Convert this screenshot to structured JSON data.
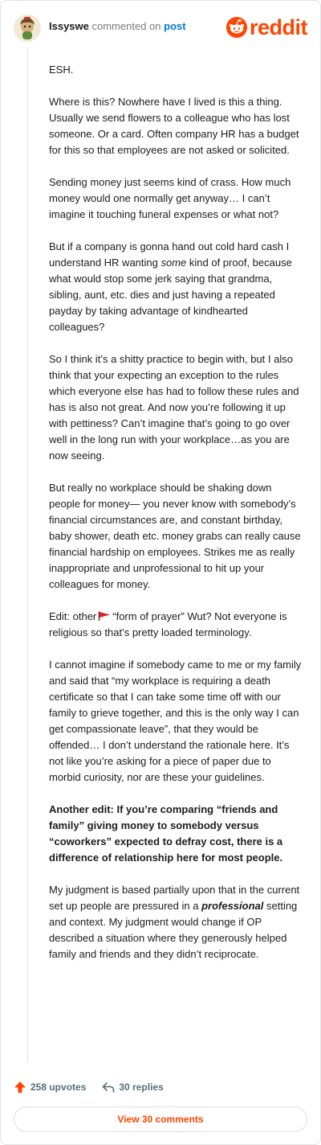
{
  "header": {
    "username": "Issyswe",
    "commented_on": "commented on",
    "post_link": "post",
    "brand": "reddit"
  },
  "comment": {
    "p1": "ESH.",
    "p2": "Where is this? Nowhere have I lived is this a thing. Usually we send flowers to a colleague who has lost someone. Or a card. Often company HR has a budget for this so that employees are not asked or solicited.",
    "p3": "Sending money just seems kind of crass. How much money would one normally get anyway… I can’t imagine it touching funeral expenses or what not?",
    "p4_a": "But if a company is gonna hand out cold hard cash I understand HR wanting ",
    "p4_em": "some",
    "p4_b": " kind of proof, because what would stop some jerk saying that grandma, sibling, aunt, etc. dies and just having a repeated payday by taking advantage of kindhearted colleagues?",
    "p5": "So I think it’s a shitty practice to begin with, but I also think that your expecting an exception to the rules which everyone else has had to follow these rules and has is also not great. And now you’re following it up with pettiness? Can’t imagine that’s going to go over well in the long run with your workplace…as you are now seeing.",
    "p6": "But really no workplace should be shaking down people for money— you never know with somebody’s financial circumstances are, and constant birthday, baby shower, death etc. money grabs can really cause financial hardship on employees. Strikes me as really inappropriate and unprofessional to hit up your colleagues for money.",
    "p7_a": "Edit: other",
    "p7_b": "“form of prayer” Wut? Not everyone is religious so that’s pretty loaded terminology.",
    "p8": "I cannot imagine if somebody came to me or my family and said that “my workplace is requiring a death certificate so that I can take some time off with our family to grieve together, and this is the only way I can get compassionate leave”, that they would be offended… I don’t understand the rationale here. It’s not like you’re asking for a piece of paper due to morbid curiosity, nor are these your guidelines.",
    "p9": "Another edit: If you’re comparing “friends and family” giving money to somebody versus “coworkers” expected to defray cost, there is a difference of relationship here for most people.",
    "p10_a": "My judgment is based partially upon that in the current set up people are pressured in a ",
    "p10_em": "professional",
    "p10_b": " setting and context. My judgment would change if OP described a situation where they generously helped family and friends and they didn’t reciprocate."
  },
  "actions": {
    "upvotes": "258 upvotes",
    "replies": "30 replies",
    "view_comments": "View 30 comments"
  },
  "colors": {
    "brand": "#ff4500",
    "link": "#0079d3",
    "muted": "#576f76"
  },
  "icons": [
    "avatar",
    "reddit-logo-icon",
    "red-flag-icon",
    "upvote-arrow-icon",
    "reply-arrow-icon"
  ]
}
